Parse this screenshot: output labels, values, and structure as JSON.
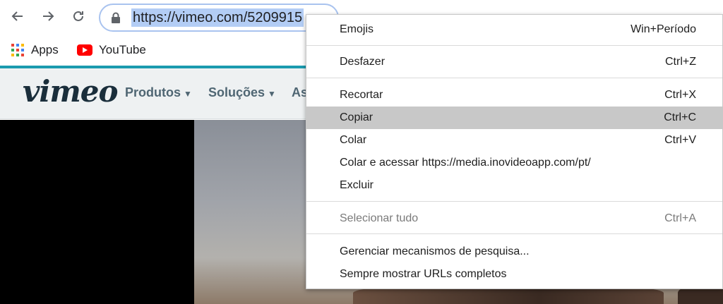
{
  "browser": {
    "url": "https://vimeo.com/5209915"
  },
  "bookmarks": [
    {
      "label": "Apps",
      "icon": "apps-grid-icon"
    },
    {
      "label": "YouTube",
      "icon": "youtube-icon"
    }
  ],
  "vimeo": {
    "logo": "vimeo",
    "nav": [
      {
        "label": "Produtos"
      },
      {
        "label": "Soluções"
      },
      {
        "label": "As"
      }
    ]
  },
  "context_menu": {
    "items": [
      {
        "label": "Emojis",
        "shortcut": "Win+Período"
      },
      {
        "label": "Desfazer",
        "shortcut": "Ctrl+Z"
      },
      {
        "label": "Recortar",
        "shortcut": "Ctrl+X"
      },
      {
        "label": "Copiar",
        "shortcut": "Ctrl+C",
        "highlighted": true
      },
      {
        "label": "Colar",
        "shortcut": "Ctrl+V"
      },
      {
        "label": "Colar e acessar https://media.inovideoapp.com/pt/",
        "shortcut": ""
      },
      {
        "label": "Excluir",
        "shortcut": ""
      },
      {
        "label": "Selecionar tudo",
        "shortcut": "Ctrl+A",
        "disabled": true
      },
      {
        "label": "Gerenciar mecanismos de pesquisa...",
        "shortcut": ""
      },
      {
        "label": "Sempre mostrar URLs completos",
        "shortcut": ""
      }
    ]
  },
  "colors": {
    "highlight": "#c8c8c8",
    "url_selection": "#b3cdf5",
    "vimeo_teal": "#1b9aae",
    "youtube_red": "#ff0000"
  }
}
